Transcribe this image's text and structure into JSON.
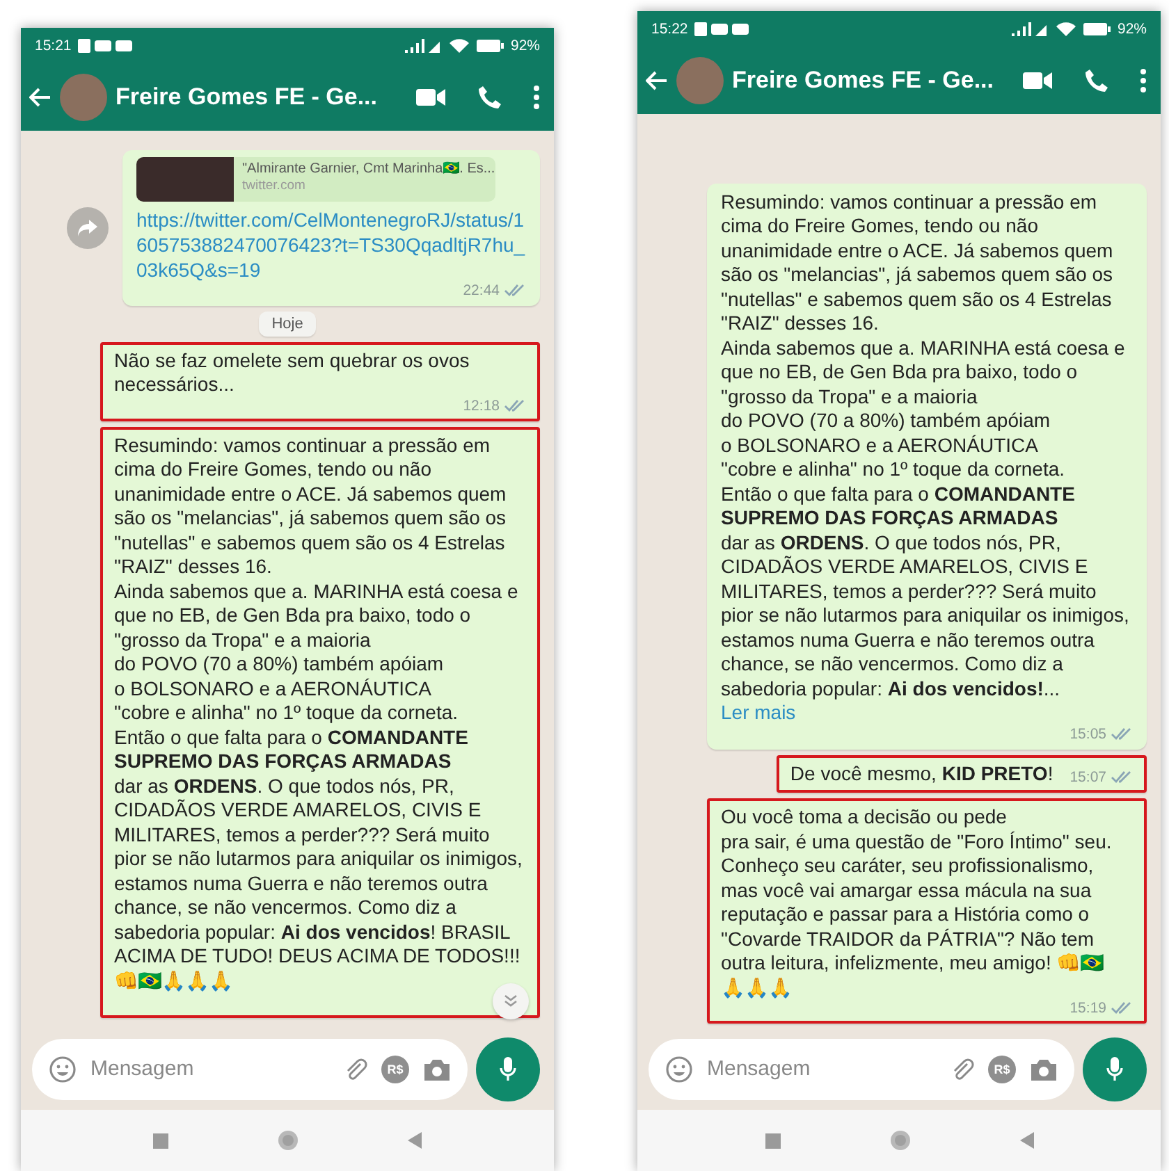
{
  "phones": [
    {
      "status_bar": {
        "time": "15:21",
        "battery": "92%"
      },
      "header": {
        "title": "Freire Gomes FE - Ge..."
      },
      "messages": [
        {
          "kind": "link_preview",
          "preview_text": "\"Almirante Garnier, Cmt Marinha🇧🇷. Es...",
          "preview_site": "twitter.com",
          "link": "https://twitter.com/CelMontenegroRJ/status/1605753882470076423?t=TS30QqadltjR7hu_03k65Q&s=19",
          "time": "22:44",
          "highlighted": false
        },
        {
          "kind": "date",
          "text": "Hoje"
        },
        {
          "kind": "text",
          "text": "Não se faz omelete sem quebrar os ovos necessários...",
          "time": "12:18",
          "highlighted": true
        },
        {
          "kind": "text",
          "text": "Resumindo: vamos continuar a pressão em cima do Freire Gomes, tendo ou não unanimidade entre o ACE. Já sabemos quem são os \"melancias\", já sabemos quem são os \"nutellas\" e sabemos quem são os 4 Estrelas \"RAIZ\" desses 16.\nAinda sabemos que a. MARINHA está coesa e que no EB, de Gen Bda pra baixo, todo o \"grosso da Tropa\" e a maioria\ndo POVO (70 a 80%) também apóiam\no BOLSONARO e a AERONÁUTICA\n\"cobre e alinha\" no 1º toque da corneta.\nEntão o que falta para o **COMANDANTE SUPREMO DAS FORÇAS ARMADAS**\ndar as **ORDENS**. O que todos nós, PR, CIDADÃOS VERDE AMARELOS, CIVIS E MILITARES, temos a perder??? Será muito pior se não lutarmos para aniquilar os inimigos, estamos numa Guerra e não teremos outra chance, se não vencermos. Como diz a sabedoria popular: **Ai dos vencidos**! BRASIL ACIMA DE TUDO! DEUS ACIMA DE TODOS!!! 👊🇧🇷🙏🙏🙏",
          "highlighted": true
        }
      ],
      "scroll_down_button": true,
      "composer": {
        "placeholder": "Mensagem",
        "payment_label": "R$"
      }
    },
    {
      "status_bar": {
        "time": "15:22",
        "battery": "92%"
      },
      "header": {
        "title": "Freire Gomes FE - Ge..."
      },
      "messages": [
        {
          "kind": "text",
          "text": "Resumindo: vamos continuar a pressão em cima do Freire Gomes, tendo ou não unanimidade entre o ACE. Já sabemos quem são os \"melancias\", já sabemos quem são os \"nutellas\" e sabemos quem são os 4 Estrelas \"RAIZ\" desses 16.\nAinda sabemos que a. MARINHA está coesa e que no EB, de Gen Bda pra baixo, todo o \"grosso da Tropa\" e a maioria\ndo POVO (70 a 80%) também apóiam\no BOLSONARO e a AERONÁUTICA\n\"cobre e alinha\" no 1º toque da corneta.\nEntão o que falta para o **COMANDANTE SUPREMO DAS FORÇAS ARMADAS**\ndar as **ORDENS**. O que todos nós, PR, CIDADÃOS VERDE AMARELOS, CIVIS E MILITARES, temos a perder??? Será muito pior se não lutarmos para aniquilar os inimigos, estamos numa Guerra e não teremos outra chance, se não vencermos. Como diz a sabedoria popular: **Ai dos vencidos!**...",
          "more_link": "Ler mais",
          "time": "15:05",
          "highlighted": false
        },
        {
          "kind": "text",
          "text": "De você mesmo, **KID PRETO**!",
          "time": "15:07",
          "highlighted": true
        },
        {
          "kind": "text",
          "text": "Ou você toma a decisão ou pede\npra sair, é uma questão de \"Foro Íntimo\" seu. Conheço seu caráter, seu profissionalismo, mas você vai amargar essa mácula na sua reputação e passar para a História como o \"Covarde TRAIDOR da PÁTRIA\"? Não tem outra leitura, infelizmente, meu amigo! 👊🇧🇷\n🙏🙏🙏",
          "time": "15:19",
          "highlighted": true
        }
      ],
      "composer": {
        "placeholder": "Mensagem",
        "payment_label": "R$"
      }
    }
  ]
}
